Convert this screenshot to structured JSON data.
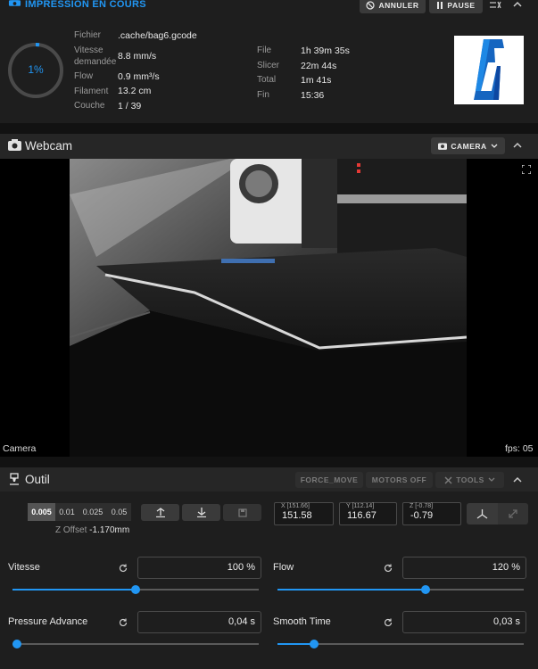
{
  "status": {
    "title": "IMPRESSION EN COURS",
    "cancel_label": "ANNULER",
    "pause_label": "PAUSE",
    "progress_percent": 1,
    "progress_text": "1%",
    "fields_left": [
      {
        "label": "Fichier",
        "value": ".cache/bag6.gcode"
      },
      {
        "label": "Vitesse demandée",
        "value": "8.8 mm/s"
      },
      {
        "label": "Flow",
        "value": "0.9 mm³/s"
      },
      {
        "label": "Filament",
        "value": "13.2 cm"
      },
      {
        "label": "Couche",
        "value": "1 / 39"
      }
    ],
    "fields_right": [
      {
        "label": "File",
        "value": "1h 39m 35s"
      },
      {
        "label": "Slicer",
        "value": "22m 44s"
      },
      {
        "label": "Total",
        "value": "1m 41s"
      },
      {
        "label": "Fin",
        "value": "15:36"
      }
    ],
    "thumbnail_color": "#1565c0"
  },
  "webcam": {
    "title": "Webcam",
    "camera_button": "CAMERA",
    "camera_name": "Camera",
    "fps": "fps: 05"
  },
  "tool": {
    "title": "Outil",
    "force_move": "FORCE_MOVE",
    "motors_off": "MOTORS OFF",
    "tools": "TOOLS",
    "steps": [
      "0.005",
      "0.01",
      "0.025",
      "0.05"
    ],
    "selected_step": "0.005",
    "z_offset_label": "Z Offset",
    "z_offset_value": "-1.170mm",
    "coords": [
      {
        "label": "X [151.66]",
        "value": "151.58"
      },
      {
        "label": "Y [112.14]",
        "value": "116.67"
      },
      {
        "label": "Z [-0.78]",
        "value": "-0.79"
      }
    ],
    "sliders": [
      {
        "name": "Vitesse",
        "value": "100 %",
        "level": 0.5
      },
      {
        "name": "Flow",
        "value": "120 %",
        "level": 0.6
      },
      {
        "name": "Pressure Advance",
        "value": "0,04 s",
        "level": 0.0
      },
      {
        "name": "Smooth Time",
        "value": "0,03 s",
        "level": 0.15
      }
    ]
  },
  "colors": {
    "accent": "#2196f3",
    "background": "#121212",
    "card": "#1e1e1e"
  }
}
